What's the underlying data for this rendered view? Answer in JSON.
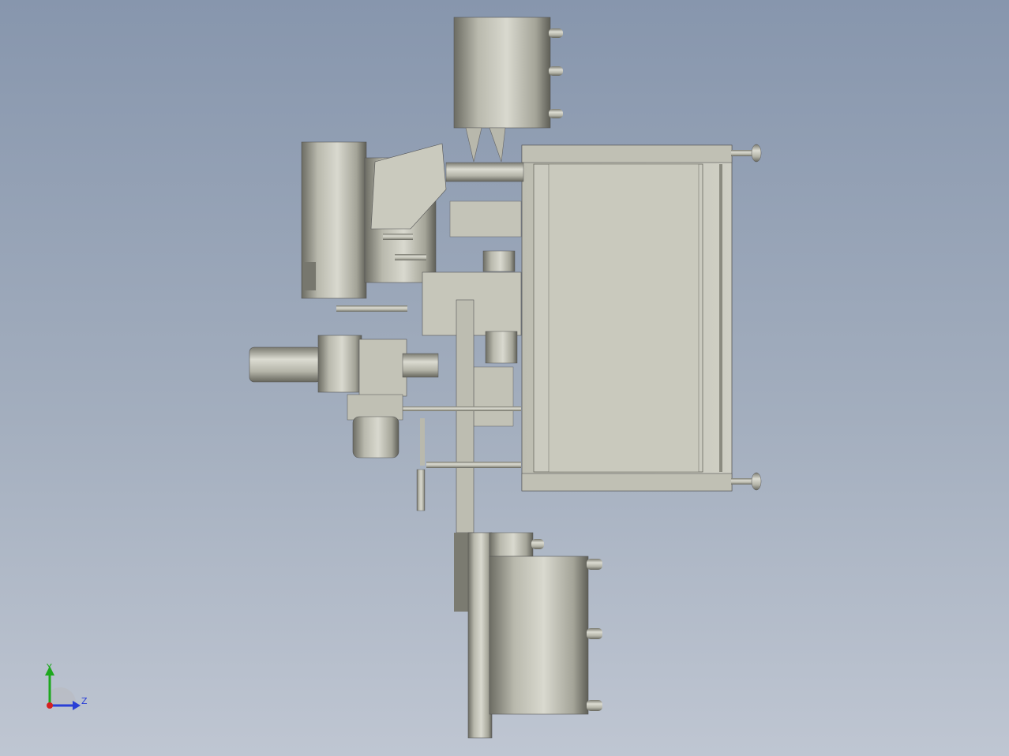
{
  "viewport": {
    "background_top": "#8796ad",
    "background_bottom": "#bfc6d2",
    "model_color": "#c8c8bc",
    "model_dark": "#6f6f66"
  },
  "triad": {
    "y_label": "Y",
    "z_label": "Z",
    "y_color": "#1ea81e",
    "z_color": "#2a3fd6",
    "x_color": "#d62020"
  }
}
